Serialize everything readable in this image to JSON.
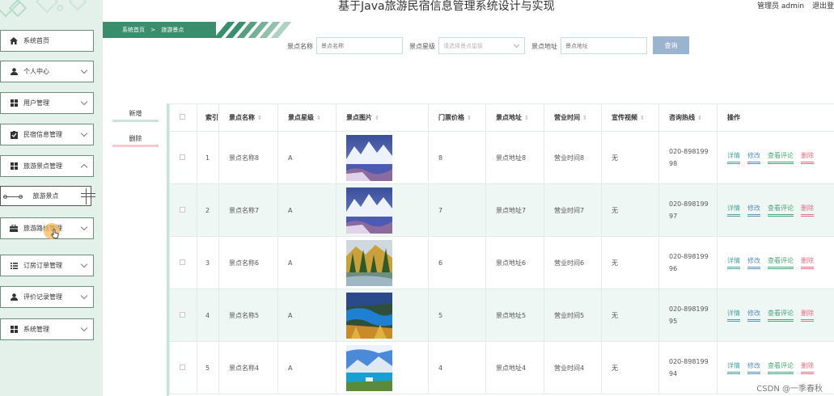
{
  "header": {
    "title": "基于Java旅游民宿信息管理系统设计与实现",
    "user_role": "管理员 admin",
    "logout": "退出登"
  },
  "breadcrumb": {
    "home": "系统首页",
    "separator": ">",
    "current": "旅游景点"
  },
  "sidebar": {
    "items": [
      {
        "label": "系统首页",
        "icon": "home-icon"
      },
      {
        "label": "个人中心",
        "icon": "person-icon"
      },
      {
        "label": "用户管理",
        "icon": "grid-icon"
      },
      {
        "label": "民宿信息管理",
        "icon": "clipboard-icon"
      },
      {
        "label": "旅游景点管理",
        "icon": "grid-icon"
      },
      {
        "label": "旅游路线管理",
        "icon": "briefcase-icon"
      },
      {
        "label": "订房订单管理",
        "icon": "list-icon"
      },
      {
        "label": "评价记录管理",
        "icon": "person-icon"
      },
      {
        "label": "系统管理",
        "icon": "grid-icon"
      }
    ],
    "active_sub": "旅游景点"
  },
  "search": {
    "name_label": "景点名称",
    "name_placeholder": "景点名称",
    "level_label": "景点星级",
    "level_placeholder": "请选择景点星级",
    "address_label": "景点地址",
    "address_placeholder": "景点地址",
    "query_button": "查询"
  },
  "actions": {
    "add": "新增",
    "delete": "删除"
  },
  "table": {
    "columns": [
      "索引",
      "景点名称",
      "景点星级",
      "景点图片",
      "门票价格",
      "景点地址",
      "营业时间",
      "宣传视频",
      "咨询热线",
      "操作"
    ],
    "row_actions": [
      "详情",
      "修改",
      "查看评论",
      "删除"
    ],
    "rows": [
      {
        "index": "1",
        "name": "景点名称8",
        "level": "A",
        "price": "8",
        "address": "景点地址8",
        "hours": "营业时间8",
        "video": "无",
        "phone_a": "020-898199",
        "phone_b": "98",
        "image": "snow-lake"
      },
      {
        "index": "2",
        "name": "景点名称7",
        "level": "A",
        "price": "7",
        "address": "景点地址7",
        "hours": "营业时间7",
        "video": "无",
        "phone_a": "020-898199",
        "phone_b": "97",
        "image": "snow-lake"
      },
      {
        "index": "3",
        "name": "景点名称6",
        "level": "A",
        "price": "6",
        "address": "景点地址6",
        "hours": "营业时间6",
        "video": "无",
        "phone_a": "020-898199",
        "phone_b": "96",
        "image": "autumn-forest"
      },
      {
        "index": "4",
        "name": "景点名称5",
        "level": "A",
        "price": "5",
        "address": "景点地址5",
        "hours": "营业时间5",
        "video": "无",
        "phone_a": "020-898199",
        "phone_b": "95",
        "image": "blue-river"
      },
      {
        "index": "5",
        "name": "景点名称4",
        "level": "A",
        "price": "4",
        "address": "景点地址4",
        "hours": "营业时间4",
        "video": "无",
        "phone_a": "020-898199",
        "phone_b": "94",
        "image": "mountain-lake"
      }
    ]
  },
  "watermark": "CSDN @一季春秋",
  "colors": {
    "accent": "#3a8e6d",
    "sidebar_bg": "#e3f1ea",
    "row_alt": "#eef7f3",
    "query_button": "#9ab4cf"
  }
}
